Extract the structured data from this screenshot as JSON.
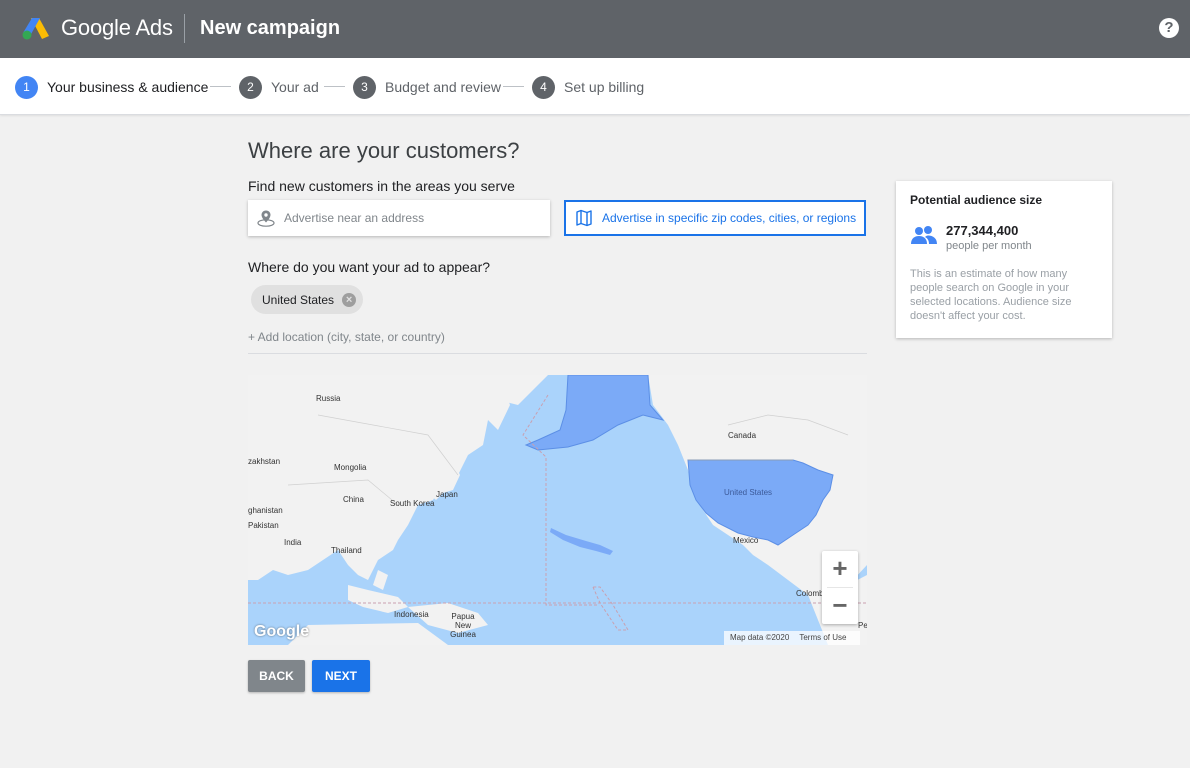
{
  "header": {
    "brand": "Google Ads",
    "title": "New campaign",
    "help": "?"
  },
  "stepper": {
    "steps": [
      {
        "num": "1",
        "label": "Your business & audience",
        "active": true
      },
      {
        "num": "2",
        "label": "Your ad"
      },
      {
        "num": "3",
        "label": "Budget and review"
      },
      {
        "num": "4",
        "label": "Set up billing"
      }
    ]
  },
  "main": {
    "title": "Where are your customers?",
    "find_label": "Find new customers in the areas you serve",
    "option_address": "Advertise near an address",
    "option_regions": "Advertise in specific zip codes, cities, or regions",
    "appear_label": "Where do you want your ad to appear?",
    "chip": "United States",
    "add_location": "+ Add location (city, state, or country)"
  },
  "map": {
    "labels": {
      "russia": "Russia",
      "kazakhstan": "zakhstan",
      "mongolia": "Mongolia",
      "china": "China",
      "afghanistan": "ghanistan",
      "pakistan": "Pakistan",
      "india": "India",
      "thailand": "Thailand",
      "south_korea": "South Korea",
      "japan": "Japan",
      "indonesia": "Indonesia",
      "papua": "Papua New Guinea",
      "canada": "Canada",
      "united_states": "United States",
      "mexico": "Mexico",
      "colombia": "Colomb",
      "peru": "Pe"
    },
    "zoom_in": "+",
    "zoom_out": "−",
    "watermark": "Google",
    "attribution": "Map data ©2020",
    "terms": "Terms of Use"
  },
  "buttons": {
    "back": "BACK",
    "next": "NEXT"
  },
  "audience": {
    "title": "Potential audience size",
    "count": "277,344,400",
    "unit": "people per month",
    "description": "This is an estimate of how many people search on Google in your selected locations. Audience size doesn't affect your cost."
  },
  "colors": {
    "header_bg": "#5f6368",
    "accent": "#1a73e8",
    "step_active": "#4285f4",
    "map_water": "#aad3fb",
    "map_highlight": "#7baaf7"
  }
}
